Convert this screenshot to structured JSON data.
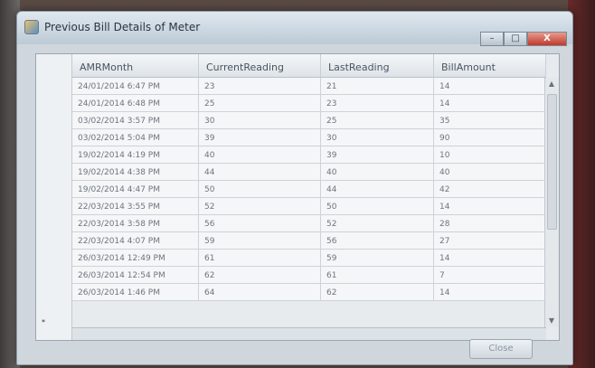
{
  "window": {
    "title": "Previous Bill Details of Meter",
    "minimize": "–",
    "maximize": "□",
    "close": "X"
  },
  "table": {
    "columns": [
      "AMRMonth",
      "CurrentReading",
      "LastReading",
      "BillAmount"
    ],
    "rows": [
      [
        "24/01/2014 6:47 PM",
        "23",
        "21",
        "14"
      ],
      [
        "24/01/2014 6:48 PM",
        "25",
        "23",
        "14"
      ],
      [
        "03/02/2014 3:57 PM",
        "30",
        "25",
        "35"
      ],
      [
        "03/02/2014 5:04 PM",
        "39",
        "30",
        "90"
      ],
      [
        "19/02/2014 4:19 PM",
        "40",
        "39",
        "10"
      ],
      [
        "19/02/2014 4:38 PM",
        "44",
        "40",
        "40"
      ],
      [
        "19/02/2014 4:47 PM",
        "50",
        "44",
        "42"
      ],
      [
        "22/03/2014 3:55 PM",
        "52",
        "50",
        "14"
      ],
      [
        "22/03/2014 3:58 PM",
        "56",
        "52",
        "28"
      ],
      [
        "22/03/2014 4:07 PM",
        "59",
        "56",
        "27"
      ],
      [
        "26/03/2014 12:49 PM",
        "61",
        "59",
        "14"
      ],
      [
        "26/03/2014 12:54 PM",
        "62",
        "61",
        "7"
      ],
      [
        "26/03/2014 1:46 PM",
        "64",
        "62",
        "14"
      ]
    ],
    "new_row_marker": "*"
  },
  "footer": {
    "close_label": "Close"
  }
}
